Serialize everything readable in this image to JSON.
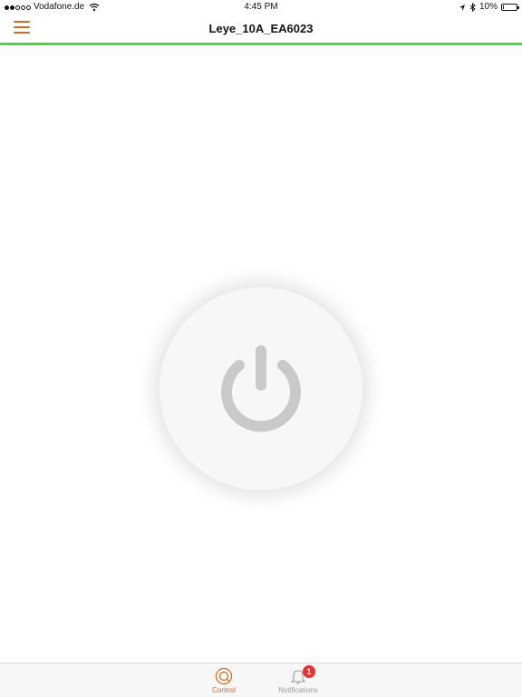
{
  "status_bar": {
    "carrier": "Vodafone.de",
    "time": "4:45 PM",
    "battery_percent": "10%",
    "battery_level": 0.1,
    "signal_bars_filled": 2,
    "signal_bars_total": 5
  },
  "navbar": {
    "title": "Leye_10A_EA6023",
    "menu_icon": "hamburger-menu-icon",
    "accent_line_color": "#3bdc3b"
  },
  "main": {
    "power_button_icon": "power-icon",
    "power_state": "off"
  },
  "tab_bar": {
    "tabs": [
      {
        "label": "Control",
        "icon": "control-icon",
        "active": true
      },
      {
        "label": "Notifications",
        "icon": "bell-icon",
        "active": false,
        "badge": "1"
      }
    ]
  },
  "colors": {
    "accent": "#d2691e",
    "badge": "#e3342f",
    "inactive": "#9a9a9a"
  }
}
